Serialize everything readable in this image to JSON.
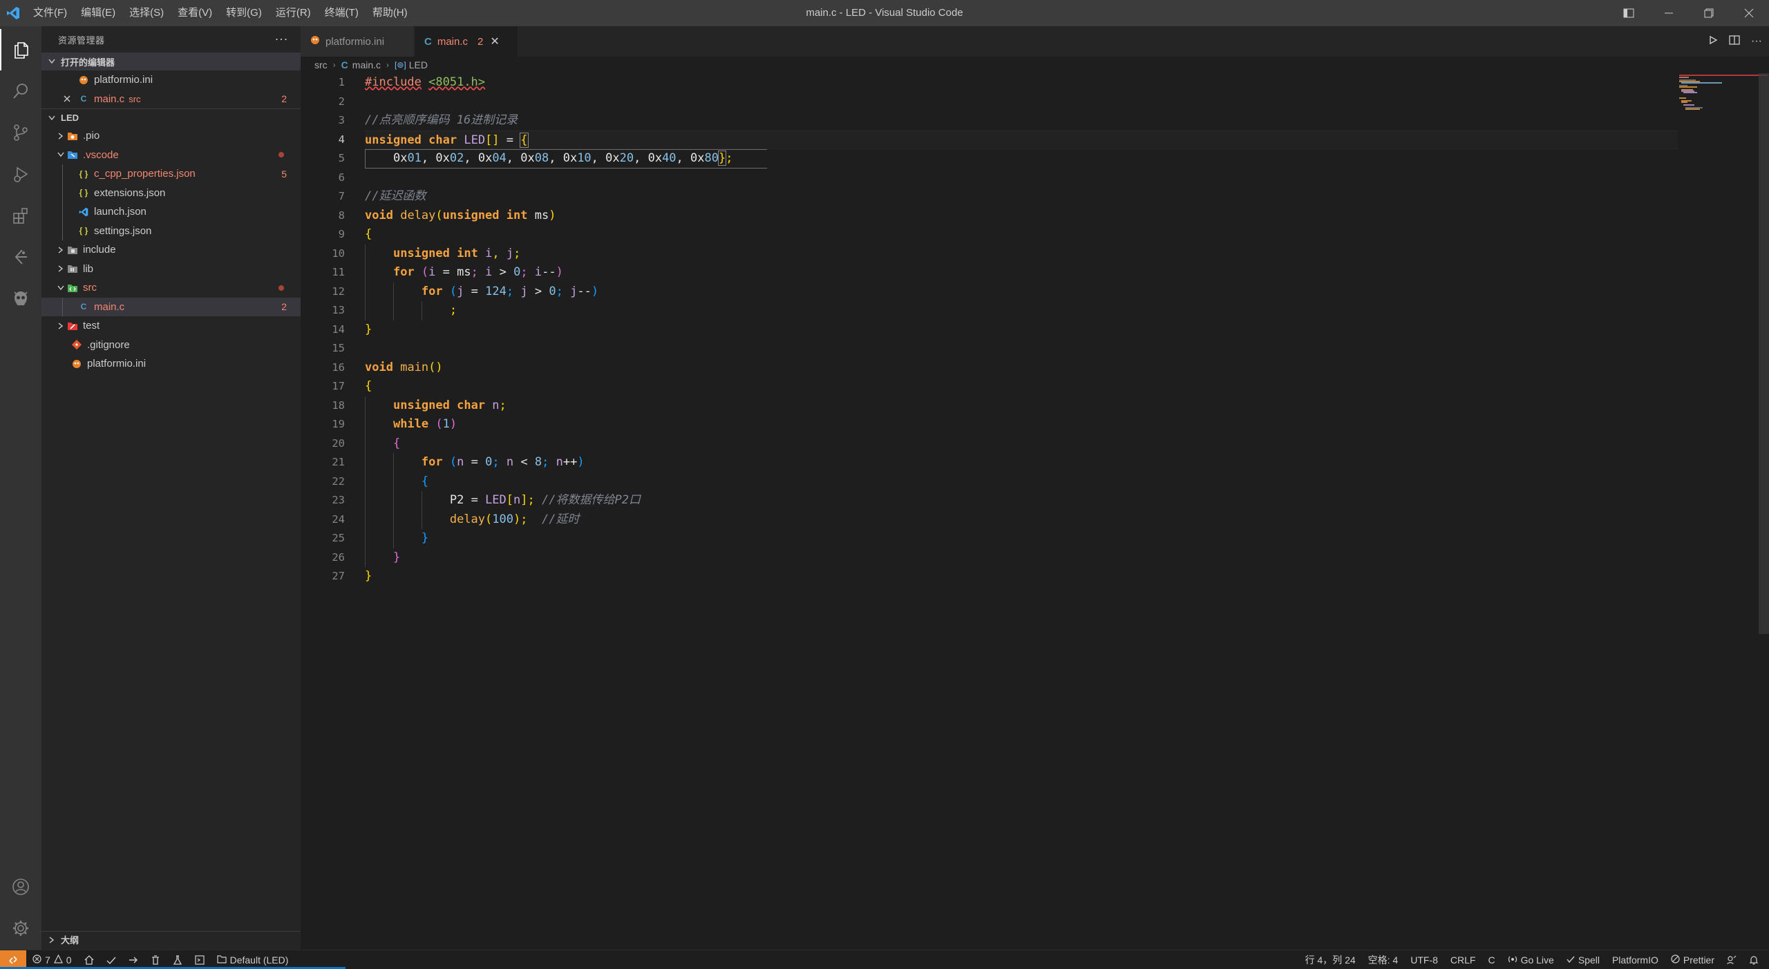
{
  "window": {
    "title": "main.c - LED - Visual Studio Code",
    "menu": [
      "文件(F)",
      "编辑(E)",
      "选择(S)",
      "查看(V)",
      "转到(G)",
      "运行(R)",
      "终端(T)",
      "帮助(H)"
    ]
  },
  "activity": [
    "files-icon",
    "search-icon",
    "source-control-icon",
    "run-debug-icon",
    "extensions-icon",
    "remote-icon",
    "platformio-icon",
    "account-icon",
    "settings-gear-icon"
  ],
  "sidebar": {
    "title": "资源管理器",
    "open_editors_label": "打开的编辑器",
    "open_editors": [
      {
        "name": "platformio.ini",
        "desc": "",
        "badge": ""
      },
      {
        "name": "main.c",
        "desc": "src",
        "badge": "2"
      }
    ],
    "folder_label": "LED",
    "tree": [
      {
        "name": ".pio",
        "badge": ""
      },
      {
        "name": ".vscode",
        "badge": ""
      },
      {
        "name": "c_cpp_properties.json",
        "badge": "5"
      },
      {
        "name": "extensions.json",
        "badge": ""
      },
      {
        "name": "launch.json",
        "badge": ""
      },
      {
        "name": "settings.json",
        "badge": ""
      },
      {
        "name": "include",
        "badge": ""
      },
      {
        "name": "lib",
        "badge": ""
      },
      {
        "name": "src",
        "badge": ""
      },
      {
        "name": "main.c",
        "badge": "2"
      },
      {
        "name": "test",
        "badge": ""
      },
      {
        "name": ".gitignore",
        "badge": ""
      },
      {
        "name": "platformio.ini",
        "badge": ""
      }
    ],
    "outline_label": "大纲"
  },
  "tabs": [
    {
      "label": "platformio.ini",
      "count": ""
    },
    {
      "label": "main.c",
      "count": "2"
    }
  ],
  "breadcrumb": [
    "src",
    "main.c",
    "LED"
  ],
  "editor": {
    "line_numbers": [
      "1",
      "2",
      "3",
      "4",
      "5",
      "6",
      "7",
      "8",
      "9",
      "10",
      "11",
      "12",
      "13",
      "14",
      "15",
      "16",
      "17",
      "18",
      "19",
      "20",
      "21",
      "22",
      "23",
      "24",
      "25",
      "26",
      "27"
    ],
    "current_line": 4
  },
  "status": {
    "errors": "7",
    "warnings": "0",
    "env": "Default (LED)",
    "cursor": "行 4，列 24",
    "spaces": "空格: 4",
    "encoding": "UTF-8",
    "eol": "CRLF",
    "language": "C",
    "golive": "Go Live",
    "spell": "Spell",
    "platformio": "PlatformIO",
    "prettier": "Prettier"
  },
  "colors": {
    "accent": "#0e70c0",
    "remote": "#e8822b",
    "error": "#f48771",
    "keyword": "#f5a340"
  }
}
